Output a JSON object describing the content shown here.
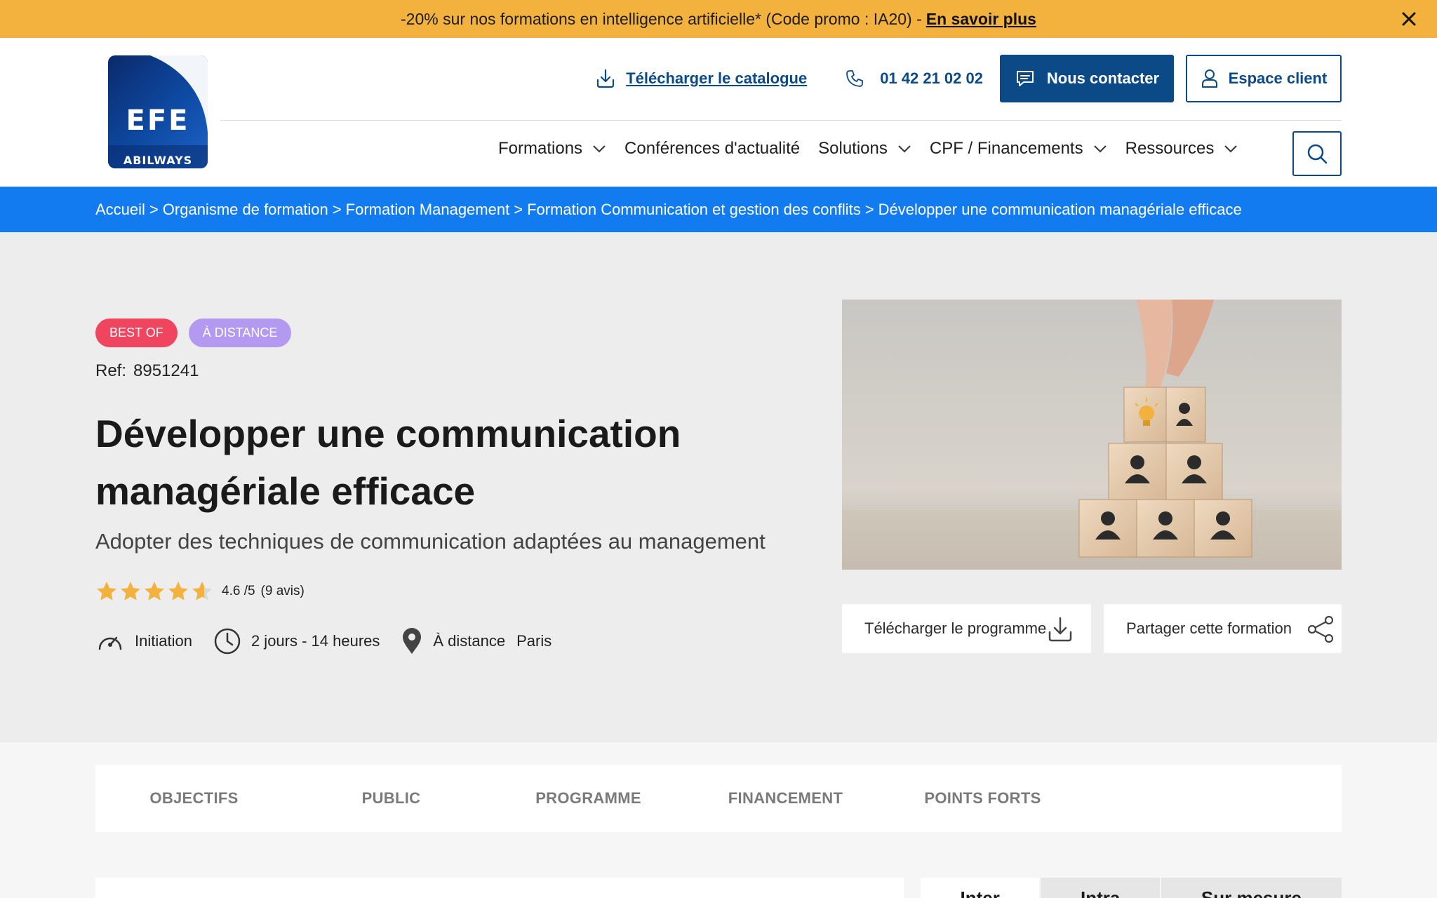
{
  "promo": {
    "text": "-20% sur nos formations en intelligence artificielle* (Code promo : IA20) -",
    "link": "En savoir plus",
    "bg_color": "#f3b23e"
  },
  "logo": {
    "main": "EFE",
    "sub": "ABILWAYS"
  },
  "header": {
    "catalog_label": "Télécharger le catalogue",
    "phone": "01 42 21 02 02",
    "contact_label": "Nous contacter",
    "client_label": "Espace client",
    "brand_color": "#0b4a86"
  },
  "nav": {
    "items": [
      {
        "label": "Formations",
        "has_dropdown": true
      },
      {
        "label": "Conférences d'actualité",
        "has_dropdown": false
      },
      {
        "label": "Solutions",
        "has_dropdown": true
      },
      {
        "label": "CPF / Financements",
        "has_dropdown": true
      },
      {
        "label": "Ressources",
        "has_dropdown": true
      }
    ]
  },
  "breadcrumb": {
    "items": [
      "Accueil",
      "Organisme de formation",
      "Formation Management",
      "Formation Communication et gestion des conflits",
      "Développer une communication managériale efficace"
    ],
    "separator": ">",
    "bg_color": "#127bf0"
  },
  "course": {
    "badges": [
      "Best of",
      "À distance"
    ],
    "ref_label": "Ref:",
    "ref_value": "8951241",
    "title": "Développer une communication managériale efficace",
    "subtitle": "Adopter des techniques de communication adaptées au management",
    "rating": {
      "stars": 4.6,
      "score": "4.6 /5",
      "reviews": "(9 avis)"
    },
    "level": "Initiation",
    "duration": "2 jours - 14 heures",
    "mode": "À distance",
    "city": "Paris",
    "download_label": "Télécharger le programme",
    "share_label": "Partager cette formation"
  },
  "tabs": {
    "items": [
      "OBJECTIFS",
      "PUBLIC",
      "PROGRAMME",
      "FINANCEMENT",
      "POINTS FORTS"
    ]
  },
  "session_tabs": [
    "Inter",
    "Intra",
    "Sur mesure"
  ]
}
